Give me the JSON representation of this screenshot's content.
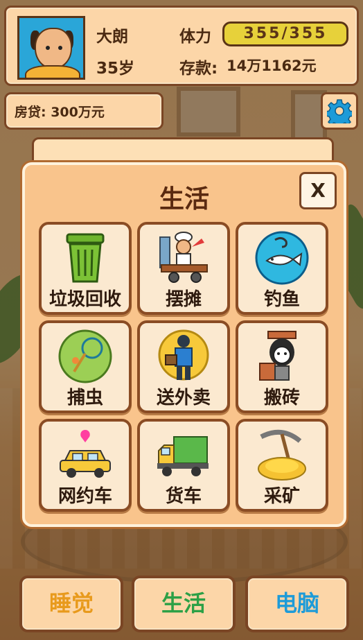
{
  "header": {
    "name": "大朗",
    "age": "35岁",
    "stamina_label": "体力",
    "stamina_value": "355/355",
    "savings_label": "存款:",
    "savings_value": "14万1162元"
  },
  "loan": {
    "text": "房贷: 300万元"
  },
  "modal": {
    "title": "生活",
    "close_label": "X",
    "tiles": [
      {
        "label": "垃圾回收",
        "icon": "trash-can-icon"
      },
      {
        "label": "摆摊",
        "icon": "street-vendor-icon"
      },
      {
        "label": "钓鱼",
        "icon": "fish-hook-icon"
      },
      {
        "label": "捕虫",
        "icon": "bug-net-icon"
      },
      {
        "label": "送外卖",
        "icon": "delivery-rider-icon"
      },
      {
        "label": "搬砖",
        "icon": "brick-carrier-icon"
      },
      {
        "label": "网约车",
        "icon": "taxi-icon"
      },
      {
        "label": "货车",
        "icon": "truck-icon"
      },
      {
        "label": "采矿",
        "icon": "pickaxe-gold-icon"
      }
    ]
  },
  "nav": {
    "sleep": "睡觉",
    "life": "生活",
    "computer": "电脑"
  },
  "colors": {
    "panel": "#fcd6a8",
    "border": "#7a4524",
    "stamina_bar": "#e7d13a",
    "nav_sleep": "#e89a1c",
    "nav_life": "#2ca046",
    "nav_pc": "#1d9bd8"
  }
}
